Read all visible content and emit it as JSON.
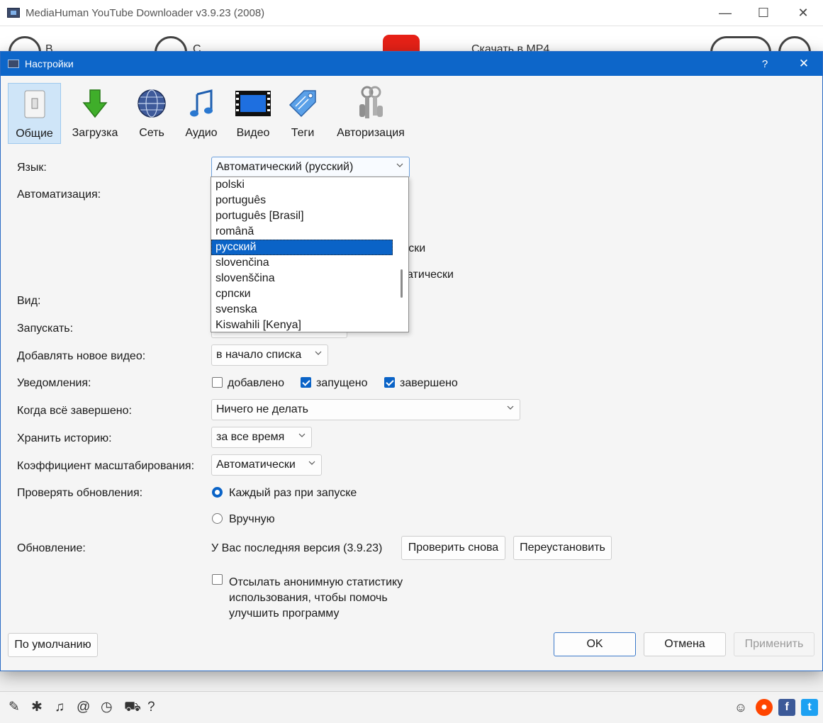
{
  "app": {
    "title": "MediaHuman YouTube Downloader v3.9.23 (2008)",
    "toolbar_fragments": [
      "В",
      "С",
      "Скачать в MP4"
    ]
  },
  "dialog": {
    "title": "Настройки",
    "help_glyph": "?",
    "close_glyph": "✕"
  },
  "tabs": [
    {
      "label": "Общие",
      "icon": "switch-icon",
      "active": true
    },
    {
      "label": "Загрузка",
      "icon": "download-arrow-icon"
    },
    {
      "label": "Сеть",
      "icon": "globe-icon"
    },
    {
      "label": "Аудио",
      "icon": "music-note-icon"
    },
    {
      "label": "Видео",
      "icon": "film-strip-icon"
    },
    {
      "label": "Теги",
      "icon": "tag-icon"
    },
    {
      "label": "Авторизация",
      "icon": "keys-icon"
    }
  ],
  "general": {
    "language_label": "Язык:",
    "language_value": "Автоматический (русский)",
    "automation_label": "Автоматизация:",
    "automation_fragments": [
      "ки",
      "чески",
      "матически"
    ],
    "view_label": "Вид:",
    "launch_label": "Запускать:",
    "add_video_label": "Добавлять новое видео:",
    "add_video_value": "в начало списка",
    "notifications_label": "Уведомления:",
    "notif_added": "добавлено",
    "notif_started": "запущено",
    "notif_finished": "завершено",
    "when_done_label": "Когда всё завершено:",
    "when_done_value": "Ничего не делать",
    "history_label": "Хранить историю:",
    "history_value": "за все время",
    "scale_label": "Коэффициент масштабирования:",
    "scale_value": "Автоматически",
    "check_updates_label": "Проверять обновления:",
    "update_each_start": "Каждый раз при запуске",
    "update_manual": "Вручную",
    "update_label": "Обновление:",
    "update_status": "У Вас последняя версия (3.9.23)",
    "check_again_button": "Проверить снова",
    "reinstall_button": "Переустановить",
    "stats_line1": "Отсылать анонимную статистику",
    "stats_line2": "использования, чтобы помочь",
    "stats_line3": "улучшить программу"
  },
  "language_options": [
    "polski",
    "português",
    "português [Brasil]",
    "română",
    "русский",
    "slovenčina",
    "slovenščina",
    "српски",
    "svenska",
    "Kiswahili [Kenya]"
  ],
  "selected_language": "русский",
  "footer": {
    "defaults_button": "По умолчанию",
    "ok_button": "OK",
    "cancel_button": "Отмена",
    "apply_button": "Применить"
  },
  "colors": {
    "accent": "#0d66c9",
    "selection": "#0a63c7",
    "youtube_red": "#e62117"
  }
}
